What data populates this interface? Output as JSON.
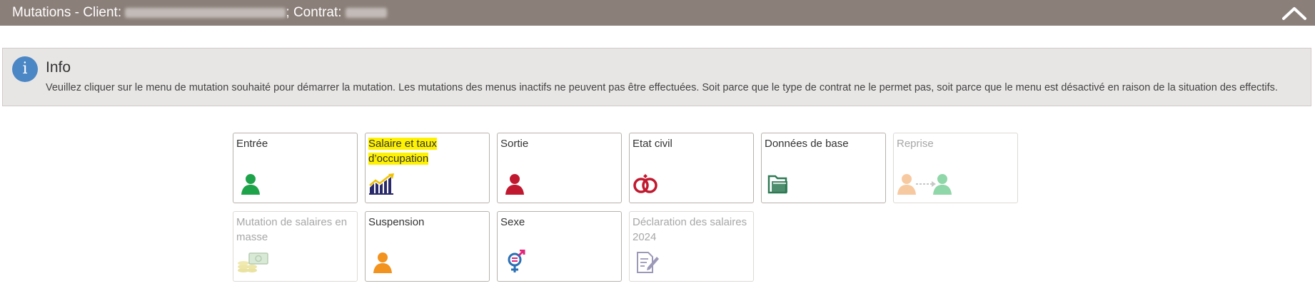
{
  "header": {
    "title_prefix": "Mutations - Client:",
    "title_middle": "; Contrat:"
  },
  "info": {
    "icon": "i",
    "title": "Info",
    "text": "Veuillez cliquer sur le menu de mutation souhaité pour démarrer la mutation. Les mutations des menus inactifs ne peuvent pas être effectuées. Soit parce que le type de contrat ne le permet pas, soit parce que le menu est désactivé en raison de la situation des effectifs."
  },
  "tiles": [
    {
      "label": "Entrée",
      "icon": "person-green-icon",
      "enabled": true
    },
    {
      "label": "Salaire et taux d’occupation",
      "icon": "salary-chart-icon",
      "enabled": true,
      "highlighted": true
    },
    {
      "label": "Sortie",
      "icon": "person-red-icon",
      "enabled": true
    },
    {
      "label": "Etat civil",
      "icon": "rings-icon",
      "enabled": true
    },
    {
      "label": "Données de base",
      "icon": "folder-icon",
      "enabled": true
    },
    {
      "label": "Reprise",
      "icon": "person-transfer-icon",
      "enabled": false
    },
    {
      "label": "Mutation de salaires en masse",
      "icon": "money-stack-icon",
      "enabled": false
    },
    {
      "label": "Suspension",
      "icon": "person-orange-icon",
      "enabled": true
    },
    {
      "label": "Sexe",
      "icon": "gender-icon",
      "enabled": true
    },
    {
      "label": "Déclaration des salaires 2024",
      "icon": "document-pen-icon",
      "enabled": false
    }
  ],
  "colors": {
    "titlebar": "#8b7f79",
    "info_bg": "#e8e6e5",
    "info_icon": "#4b87c4",
    "highlight": "#fff200"
  }
}
